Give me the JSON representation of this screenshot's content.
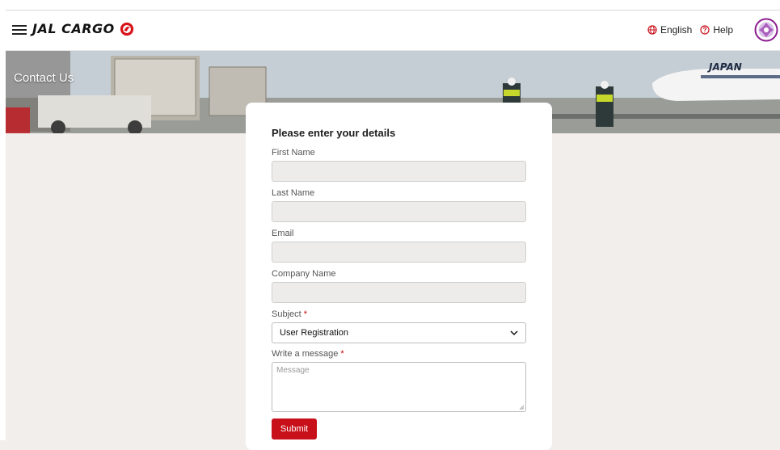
{
  "header": {
    "brand": "JAL CARGO",
    "language_label": "English",
    "help_label": "Help"
  },
  "hero": {
    "title": "Contact Us"
  },
  "form": {
    "heading": "Please enter your details",
    "fields": {
      "first_name": {
        "label": "First Name",
        "value": ""
      },
      "last_name": {
        "label": "Last Name",
        "value": ""
      },
      "email": {
        "label": "Email",
        "value": ""
      },
      "company_name": {
        "label": "Company Name",
        "value": ""
      },
      "subject": {
        "label": "Subject",
        "required_mark": "*",
        "selected": "User Registration"
      },
      "message": {
        "label": "Write a message",
        "required_mark": "*",
        "placeholder": "Message",
        "value": ""
      }
    },
    "submit_label": "Submit"
  },
  "colors": {
    "brand_red": "#c8101a",
    "page_background": "#f2eeec",
    "input_background": "#eeeceb"
  },
  "icons": [
    "hamburger-icon",
    "jal-crane-logo",
    "globe-icon",
    "help-circle-icon",
    "avatar-icon",
    "chevron-down-icon",
    "resize-handle-icon"
  ]
}
